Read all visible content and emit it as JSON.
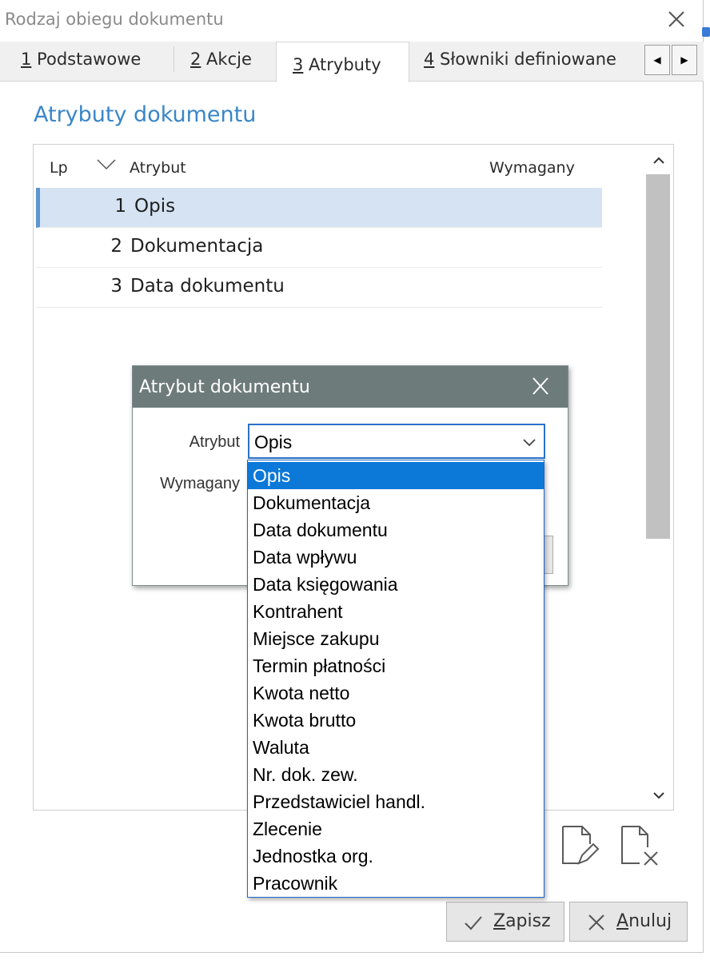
{
  "window": {
    "title": "Rodzaj obiegu dokumentu"
  },
  "tabs": [
    {
      "key": "1",
      "label": " Podstawowe"
    },
    {
      "key": "2",
      "label": " Akcje"
    },
    {
      "key": "3",
      "label": " Atrybuty"
    },
    {
      "key": "4",
      "label": " Słowniki definiowane"
    }
  ],
  "section_title": "Atrybuty dokumentu",
  "grid": {
    "columns": {
      "lp": "Lp",
      "attribute": "Atrybut",
      "required": "Wymagany"
    },
    "rows": [
      {
        "lp": "1",
        "name": "Opis",
        "selected": true
      },
      {
        "lp": "2",
        "name": "Dokumentacja",
        "selected": false
      },
      {
        "lp": "3",
        "name": "Data dokumentu",
        "selected": false
      }
    ]
  },
  "dialog": {
    "title": "Atrybut dokumentu",
    "attribute_label": "Atrybut",
    "required_label": "Wymagany",
    "attribute_value": "Opis",
    "options": [
      "Opis",
      "Dokumentacja",
      "Data dokumentu",
      "Data wpływu",
      "Data księgowania",
      "Kontrahent",
      "Miejsce zakupu",
      "Termin płatności",
      "Kwota netto",
      "Kwota brutto",
      "Waluta",
      "Nr. dok. zew.",
      "Przedstawiciel handl.",
      "Zlecenie",
      "Jednostka org.",
      "Pracownik"
    ],
    "selected_option": "Opis"
  },
  "buttons": {
    "save": {
      "key": "Z",
      "rest": "apisz"
    },
    "cancel": {
      "key": "A",
      "rest": "nuluj"
    }
  },
  "icons": [
    "close-icon",
    "edit-document-icon",
    "delete-document-icon",
    "check-icon",
    "x-icon",
    "chevron-down-icon",
    "sort-indicator-icon"
  ],
  "colors": {
    "accent": "#3a86c8",
    "selection": "#0c78d8",
    "row_selected": "#d5e3f3",
    "dialog_title": "#6e7b7b"
  }
}
